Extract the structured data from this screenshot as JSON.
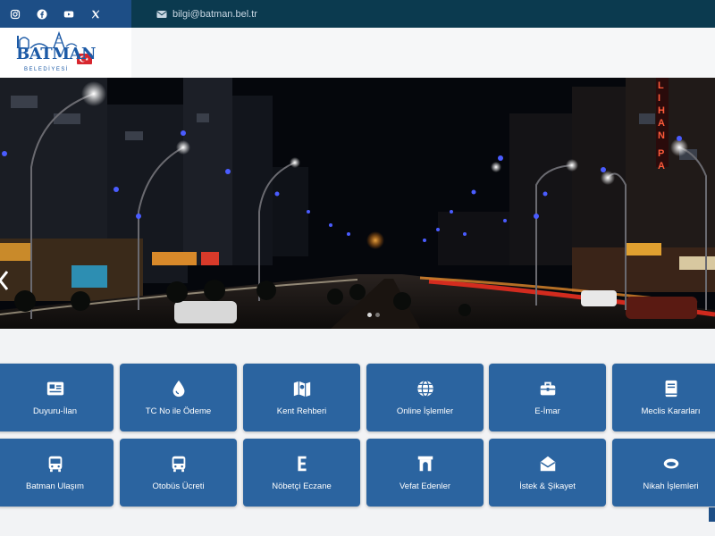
{
  "topbar": {
    "social": [
      {
        "name": "instagram-icon"
      },
      {
        "name": "facebook-icon"
      },
      {
        "name": "youtube-icon"
      },
      {
        "name": "x-twitter-icon"
      }
    ],
    "email": "bilgi@batman.bel.tr"
  },
  "header": {
    "logo_title": "BATMAN",
    "logo_subtitle": "BELEDİYESİ"
  },
  "hero": {
    "sign_text": "LIHAN PARK",
    "slide_dots": 2
  },
  "services": [
    {
      "label": "Duyuru-İlan",
      "icon": "news-card-icon"
    },
    {
      "label": "TC No ile Ödeme",
      "icon": "water-drop-icon"
    },
    {
      "label": "Kent Rehberi",
      "icon": "map-icon"
    },
    {
      "label": "Online İşlemler",
      "icon": "globe-icon"
    },
    {
      "label": "E-İmar",
      "icon": "toolbox-icon"
    },
    {
      "label": "Meclis Kararları",
      "icon": "book-icon"
    },
    {
      "label": "Batman Ulaşım",
      "icon": "bus-icon"
    },
    {
      "label": "Otobüs Ücreti",
      "icon": "bus-icon"
    },
    {
      "label": "Nöbetçi Eczane",
      "icon": "pharmacy-e-icon"
    },
    {
      "label": "Vefat Edenler",
      "icon": "arch-icon"
    },
    {
      "label": "İstek & Şikayet",
      "icon": "envelope-open-icon"
    },
    {
      "label": "Nikah İşlemleri",
      "icon": "rings-icon"
    }
  ],
  "colors": {
    "topbar": "#0b3a4f",
    "social_bg": "#1d4e86",
    "tile": "#2b64a0",
    "brand": "#1c5aa6"
  }
}
